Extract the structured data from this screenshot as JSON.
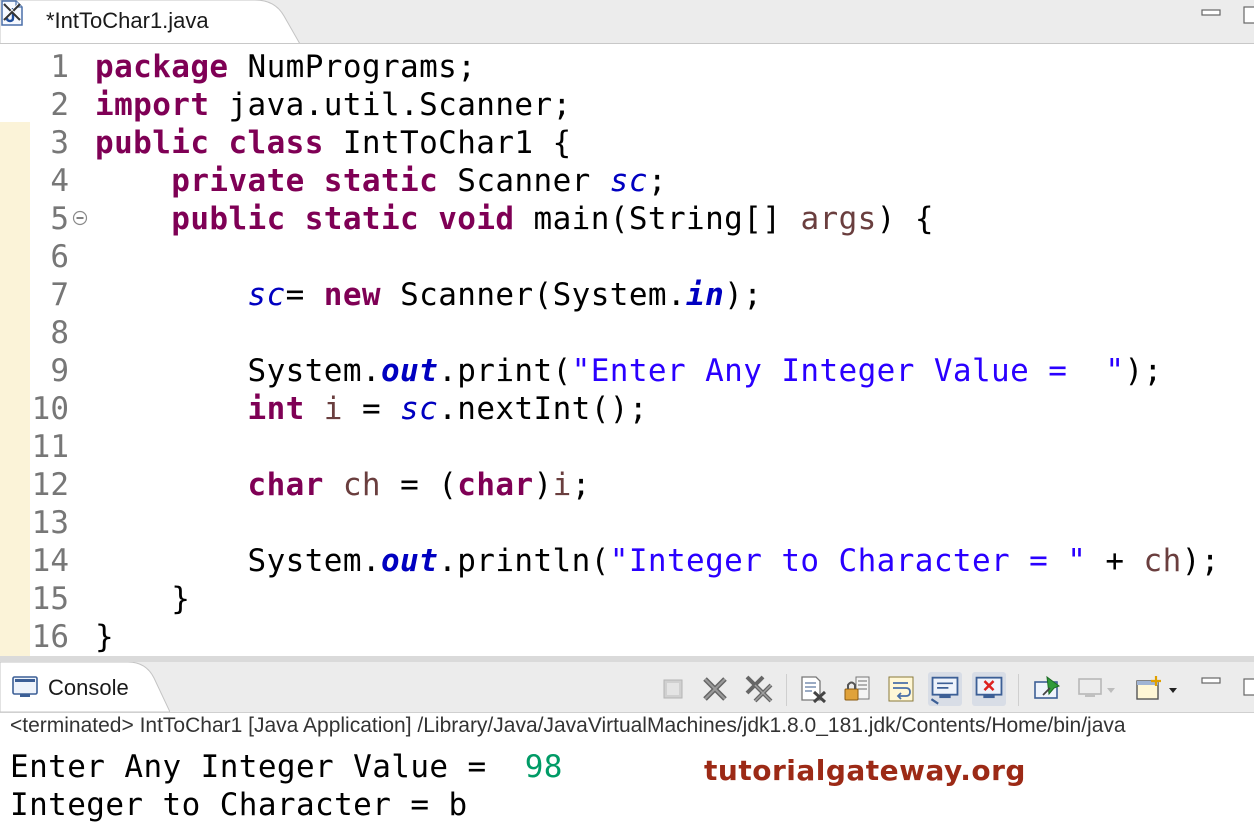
{
  "editor": {
    "tab_title": "*IntToChar1.java",
    "lines": [
      {
        "n": "1",
        "tokens": [
          {
            "t": "package",
            "c": "kw"
          },
          {
            "t": " NumPrograms;"
          }
        ]
      },
      {
        "n": "2",
        "tokens": [
          {
            "t": "import",
            "c": "kw"
          },
          {
            "t": " java.util.Scanner;"
          }
        ]
      },
      {
        "n": "3",
        "tokens": [
          {
            "t": "public",
            "c": "kw"
          },
          {
            "t": " "
          },
          {
            "t": "class",
            "c": "kw"
          },
          {
            "t": " IntToChar1 {"
          }
        ]
      },
      {
        "n": "4",
        "tokens": [
          {
            "t": "    "
          },
          {
            "t": "private",
            "c": "kw"
          },
          {
            "t": " "
          },
          {
            "t": "static",
            "c": "kw"
          },
          {
            "t": " Scanner "
          },
          {
            "t": "sc",
            "c": "fld"
          },
          {
            "t": ";"
          }
        ]
      },
      {
        "n": "5",
        "tokens": [
          {
            "t": "    "
          },
          {
            "t": "public",
            "c": "kw"
          },
          {
            "t": " "
          },
          {
            "t": "static",
            "c": "kw"
          },
          {
            "t": " "
          },
          {
            "t": "void",
            "c": "kw"
          },
          {
            "t": " main(String[] "
          },
          {
            "t": "args",
            "c": "var"
          },
          {
            "t": ") {"
          }
        ]
      },
      {
        "n": "6",
        "tokens": []
      },
      {
        "n": "7",
        "tokens": [
          {
            "t": "        "
          },
          {
            "t": "sc",
            "c": "fld"
          },
          {
            "t": "= "
          },
          {
            "t": "new",
            "c": "kw"
          },
          {
            "t": " Scanner(System."
          },
          {
            "t": "in",
            "c": "fldb"
          },
          {
            "t": ");"
          }
        ]
      },
      {
        "n": "8",
        "tokens": []
      },
      {
        "n": "9",
        "tokens": [
          {
            "t": "        System."
          },
          {
            "t": "out",
            "c": "fldb"
          },
          {
            "t": ".print("
          },
          {
            "t": "\"Enter Any Integer Value =  \"",
            "c": "str"
          },
          {
            "t": ");"
          }
        ]
      },
      {
        "n": "10",
        "tokens": [
          {
            "t": "        "
          },
          {
            "t": "int",
            "c": "kw"
          },
          {
            "t": " "
          },
          {
            "t": "i",
            "c": "var"
          },
          {
            "t": " = "
          },
          {
            "t": "sc",
            "c": "fld"
          },
          {
            "t": ".nextInt();"
          }
        ]
      },
      {
        "n": "11",
        "tokens": []
      },
      {
        "n": "12",
        "tokens": [
          {
            "t": "        "
          },
          {
            "t": "char",
            "c": "kw"
          },
          {
            "t": " "
          },
          {
            "t": "ch",
            "c": "var"
          },
          {
            "t": " = ("
          },
          {
            "t": "char",
            "c": "kw"
          },
          {
            "t": ")"
          },
          {
            "t": "i",
            "c": "var"
          },
          {
            "t": ";"
          }
        ]
      },
      {
        "n": "13",
        "tokens": []
      },
      {
        "n": "14",
        "tokens": [
          {
            "t": "        System."
          },
          {
            "t": "out",
            "c": "fldb"
          },
          {
            "t": ".println("
          },
          {
            "t": "\"Integer to Character = \"",
            "c": "str"
          },
          {
            "t": " + "
          },
          {
            "t": "ch",
            "c": "var"
          },
          {
            "t": ");"
          }
        ]
      },
      {
        "n": "15",
        "tokens": [
          {
            "t": "    }"
          }
        ]
      },
      {
        "n": "16",
        "tokens": [
          {
            "t": "}"
          }
        ]
      }
    ]
  },
  "console": {
    "tab_title": "Console",
    "status": "<terminated> IntToChar1 [Java Application] /Library/Java/JavaVirtualMachines/jdk1.8.0_181.jdk/Contents/Home/bin/java",
    "output_line1_prefix": "Enter Any Integer Value =  ",
    "output_line1_input": "98",
    "output_line2": "Integer to Character = b",
    "watermark": "tutorialgateway.org"
  }
}
